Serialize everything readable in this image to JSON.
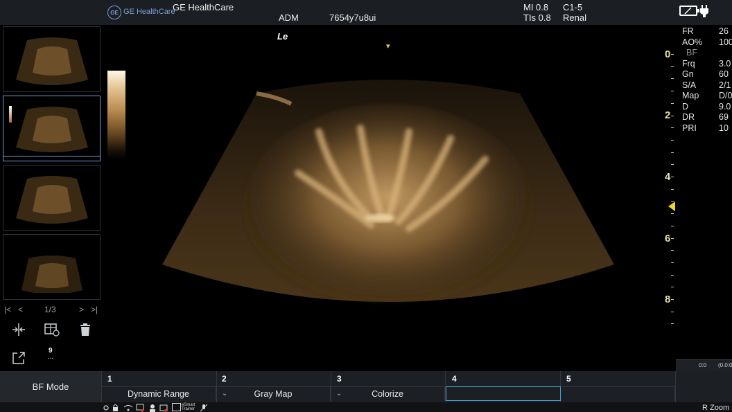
{
  "header": {
    "brand": "GE HealthCare",
    "logo_text": "GE",
    "operator": "ADM",
    "patient_id": "7654y7u8ui",
    "mi": "MI 0.8",
    "tis": "TIs 0.8",
    "probe": "C1-5",
    "preset": "Renal",
    "battery_icon": "battery-charging-icon"
  },
  "image": {
    "orientation_label": "Le",
    "focus_marker": "▾"
  },
  "thumbnails": {
    "pager": {
      "first": "|<",
      "prev": "<",
      "page": "1/3",
      "next": ">",
      "last": ">|"
    },
    "count_badge": "9",
    "count_sub": "...",
    "tools": [
      "split-view-icon",
      "layout-icon",
      "trash-icon",
      "export-icon"
    ]
  },
  "depth_scale": {
    "labels": [
      "0",
      "2",
      "4",
      "6",
      "8"
    ]
  },
  "params": [
    {
      "label": "FR",
      "value": "26"
    },
    {
      "label": "AO%",
      "value": "100"
    },
    {
      "label": "BF",
      "value": ""
    },
    {
      "label": "Frq",
      "value": "3.0"
    },
    {
      "label": "Gn",
      "value": "60"
    },
    {
      "label": "S/A",
      "value": "2/1"
    },
    {
      "label": "Map",
      "value": "D/0"
    },
    {
      "label": "D",
      "value": "9.0"
    },
    {
      "label": "DR",
      "value": "69"
    },
    {
      "label": "PRI",
      "value": "10"
    }
  ],
  "cine": {
    "left": "0:0",
    "right": "(0.0:0."
  },
  "softkeys": {
    "mode_label": "BF Mode",
    "slots": [
      {
        "num": "1",
        "label": "Dynamic Range"
      },
      {
        "num": "2",
        "label": "Gray Map"
      },
      {
        "num": "3",
        "label": "Colorize"
      },
      {
        "num": "4",
        "label": ""
      },
      {
        "num": "5",
        "label": ""
      }
    ]
  },
  "statusbar": {
    "icons": [
      "brightness-icon",
      "lock-icon",
      "wifi-icon",
      "network-icon",
      "user-icon",
      "gallery-icon",
      "esmart-trainer-icon",
      "mic-icon"
    ],
    "esmart": "eSmart Trainer",
    "rzoom": "R Zoom"
  }
}
